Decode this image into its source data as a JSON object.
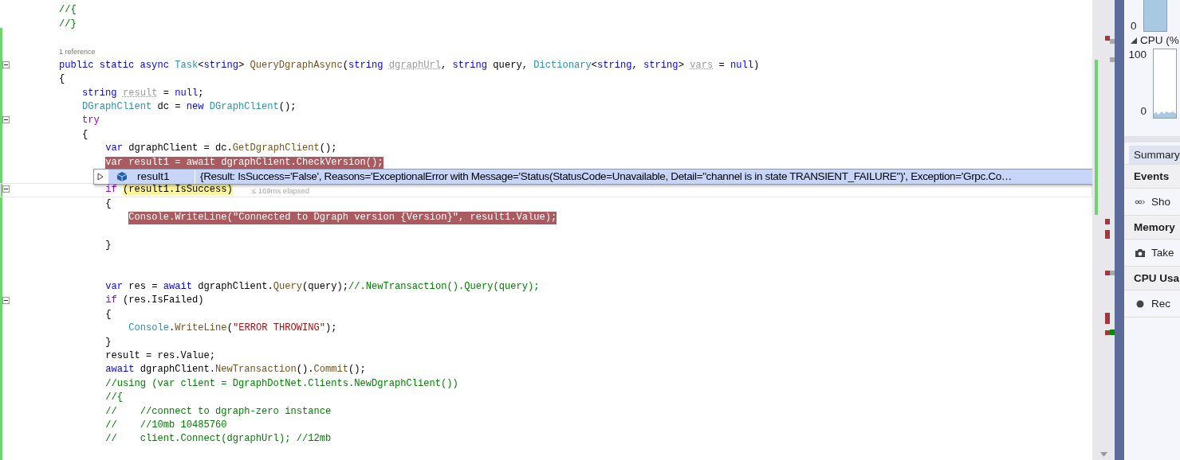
{
  "editor": {
    "lines": [
      {
        "kind": "code",
        "fold": false,
        "breakpoint": false,
        "current": false,
        "tokens": [
          {
            "kind": "comment",
            "text": "//{"
          }
        ]
      },
      {
        "kind": "code",
        "fold": false,
        "breakpoint": false,
        "current": false,
        "tokens": [
          {
            "kind": "comment",
            "text": "//}"
          }
        ]
      },
      {
        "kind": "blank"
      },
      {
        "kind": "codelens",
        "text": "1 reference"
      },
      {
        "kind": "code",
        "fold": true,
        "breakpoint": false,
        "current": false,
        "tokens": [
          {
            "kind": "kw",
            "text": "public static async "
          },
          {
            "kind": "type",
            "text": "Task"
          },
          {
            "kind": "plain",
            "text": "<"
          },
          {
            "kind": "kw",
            "text": "string"
          },
          {
            "kind": "plain",
            "text": "> "
          },
          {
            "kind": "method",
            "text": "QueryDgraphAsync"
          },
          {
            "kind": "plain",
            "text": "("
          },
          {
            "kind": "kw",
            "text": "string "
          },
          {
            "kind": "faded",
            "text": "dgraphUrl"
          },
          {
            "kind": "plain",
            "text": ", "
          },
          {
            "kind": "kw",
            "text": "string"
          },
          {
            "kind": "plain",
            "text": " query, "
          },
          {
            "kind": "type",
            "text": "Dictionary"
          },
          {
            "kind": "plain",
            "text": "<"
          },
          {
            "kind": "kw",
            "text": "string"
          },
          {
            "kind": "plain",
            "text": ", "
          },
          {
            "kind": "kw",
            "text": "string"
          },
          {
            "kind": "plain",
            "text": "> "
          },
          {
            "kind": "faded",
            "text": "vars"
          },
          {
            "kind": "plain",
            "text": " = "
          },
          {
            "kind": "kw",
            "text": "null"
          },
          {
            "kind": "plain",
            "text": ")"
          }
        ]
      },
      {
        "kind": "code",
        "fold": false,
        "breakpoint": false,
        "current": false,
        "tokens": [
          {
            "kind": "plain",
            "text": "{"
          }
        ]
      },
      {
        "kind": "code",
        "fold": false,
        "breakpoint": false,
        "current": false,
        "tokens": [
          {
            "kind": "kw",
            "text": "    string "
          },
          {
            "kind": "faded",
            "text": "result"
          },
          {
            "kind": "plain",
            "text": " = "
          },
          {
            "kind": "kw",
            "text": "null"
          },
          {
            "kind": "plain",
            "text": ";"
          }
        ]
      },
      {
        "kind": "code",
        "fold": false,
        "breakpoint": false,
        "current": false,
        "tokens": [
          {
            "kind": "type",
            "text": "    DGraphClient"
          },
          {
            "kind": "plain",
            "text": " dc = "
          },
          {
            "kind": "kw",
            "text": "new "
          },
          {
            "kind": "type",
            "text": "DGraphClient"
          },
          {
            "kind": "plain",
            "text": "();"
          }
        ]
      },
      {
        "kind": "code",
        "fold": true,
        "breakpoint": false,
        "current": false,
        "tokens": [
          {
            "kind": "ctl",
            "text": "    try"
          }
        ]
      },
      {
        "kind": "code",
        "fold": false,
        "breakpoint": false,
        "current": false,
        "tokens": [
          {
            "kind": "plain",
            "text": "    {"
          }
        ]
      },
      {
        "kind": "code",
        "fold": false,
        "breakpoint": false,
        "current": false,
        "tokens": [
          {
            "kind": "kw",
            "text": "        var"
          },
          {
            "kind": "plain",
            "text": " dgraphClient = dc."
          },
          {
            "kind": "method",
            "text": "GetDgraphClient"
          },
          {
            "kind": "plain",
            "text": "();"
          }
        ]
      },
      {
        "kind": "code",
        "fold": false,
        "breakpoint": true,
        "current": false,
        "tokens": [
          {
            "kind": "kw",
            "text": "        var"
          },
          {
            "kind": "plain",
            "text": " result1 = "
          },
          {
            "kind": "kw",
            "text": "await"
          },
          {
            "kind": "plain",
            "text": " dgraphClient."
          },
          {
            "kind": "method",
            "text": "CheckVersion"
          },
          {
            "kind": "plain",
            "text": "();"
          }
        ]
      },
      {
        "kind": "blank"
      },
      {
        "kind": "code",
        "fold": true,
        "breakpoint": false,
        "current": true,
        "hint": "≤ 169ms elapsed",
        "tokens": [
          {
            "kind": "ctl",
            "text": "        if "
          },
          {
            "kind": "active",
            "text": "(result1.IsSuccess)"
          }
        ]
      },
      {
        "kind": "code",
        "fold": false,
        "breakpoint": false,
        "current": false,
        "tokens": [
          {
            "kind": "plain",
            "text": "        {"
          }
        ]
      },
      {
        "kind": "code",
        "fold": false,
        "breakpoint": true,
        "current": false,
        "tokens": [
          {
            "kind": "type",
            "text": "            Console"
          },
          {
            "kind": "plain",
            "text": "."
          },
          {
            "kind": "method",
            "text": "WriteLine"
          },
          {
            "kind": "plain",
            "text": "("
          },
          {
            "kind": "str",
            "text": "\"Connected to Dgraph version {Version}\""
          },
          {
            "kind": "plain",
            "text": ", result1.Value);"
          }
        ]
      },
      {
        "kind": "blank"
      },
      {
        "kind": "code",
        "fold": false,
        "breakpoint": false,
        "current": false,
        "tokens": [
          {
            "kind": "plain",
            "text": "        }"
          }
        ]
      },
      {
        "kind": "blank"
      },
      {
        "kind": "blank"
      },
      {
        "kind": "code",
        "fold": false,
        "breakpoint": false,
        "current": false,
        "tokens": [
          {
            "kind": "kw",
            "text": "        var"
          },
          {
            "kind": "plain",
            "text": " res = "
          },
          {
            "kind": "kw",
            "text": "await"
          },
          {
            "kind": "plain",
            "text": " dgraphClient."
          },
          {
            "kind": "method",
            "text": "Query"
          },
          {
            "kind": "plain",
            "text": "(query);"
          },
          {
            "kind": "comment",
            "text": "//.NewTransaction().Query(query);"
          }
        ]
      },
      {
        "kind": "code",
        "fold": true,
        "breakpoint": false,
        "current": false,
        "tokens": [
          {
            "kind": "ctl",
            "text": "        if"
          },
          {
            "kind": "plain",
            "text": " (res.IsFailed)"
          }
        ]
      },
      {
        "kind": "code",
        "fold": false,
        "breakpoint": false,
        "current": false,
        "tokens": [
          {
            "kind": "plain",
            "text": "        {"
          }
        ]
      },
      {
        "kind": "code",
        "fold": false,
        "breakpoint": false,
        "current": false,
        "tokens": [
          {
            "kind": "type",
            "text": "            Console"
          },
          {
            "kind": "plain",
            "text": "."
          },
          {
            "kind": "method",
            "text": "WriteLine"
          },
          {
            "kind": "plain",
            "text": "("
          },
          {
            "kind": "str",
            "text": "\"ERROR THROWING\""
          },
          {
            "kind": "plain",
            "text": ");"
          }
        ]
      },
      {
        "kind": "code",
        "fold": false,
        "breakpoint": false,
        "current": false,
        "tokens": [
          {
            "kind": "plain",
            "text": "        }"
          }
        ]
      },
      {
        "kind": "code",
        "fold": false,
        "breakpoint": false,
        "current": false,
        "tokens": [
          {
            "kind": "plain",
            "text": "        result = res.Value;"
          }
        ]
      },
      {
        "kind": "code",
        "fold": false,
        "breakpoint": false,
        "current": false,
        "tokens": [
          {
            "kind": "kw",
            "text": "        await"
          },
          {
            "kind": "plain",
            "text": " dgraphClient."
          },
          {
            "kind": "method",
            "text": "NewTransaction"
          },
          {
            "kind": "plain",
            "text": "()."
          },
          {
            "kind": "method",
            "text": "Commit"
          },
          {
            "kind": "plain",
            "text": "();"
          }
        ]
      },
      {
        "kind": "code",
        "fold": false,
        "breakpoint": false,
        "current": false,
        "tokens": [
          {
            "kind": "comment",
            "text": "        //using (var client = DgraphDotNet.Clients.NewDgraphClient())"
          }
        ]
      },
      {
        "kind": "code",
        "fold": false,
        "breakpoint": false,
        "current": false,
        "tokens": [
          {
            "kind": "comment",
            "text": "        //{"
          }
        ]
      },
      {
        "kind": "code",
        "fold": false,
        "breakpoint": false,
        "current": false,
        "tokens": [
          {
            "kind": "comment",
            "text": "        //    //connect to dgraph-zero instance"
          }
        ]
      },
      {
        "kind": "code",
        "fold": false,
        "breakpoint": false,
        "current": false,
        "tokens": [
          {
            "kind": "comment",
            "text": "        //    //10mb 10485760"
          }
        ]
      },
      {
        "kind": "code",
        "fold": false,
        "breakpoint": false,
        "current": false,
        "tokens": [
          {
            "kind": "comment",
            "text": "        //    client.Connect(dgraphUrl); //12mb"
          }
        ]
      }
    ],
    "datatip": {
      "expanded": false,
      "name": "result1",
      "value": "{Result: IsSuccess='False', Reasons='ExceptionalError with Message='Status(StatusCode=Unavailable, Detail=\"channel is in state TRANSIENT_FAILURE\")', Exception='Grpc.Co…"
    }
  },
  "diagnostics": {
    "memory_chart": {
      "y_tick": "0"
    },
    "cpu_chart": {
      "title": "CPU (%",
      "expanded": true,
      "y_ticks": [
        "100",
        "0"
      ]
    },
    "tabs": [
      {
        "label": "Summary",
        "selected": true
      }
    ],
    "sections": [
      {
        "title": "Events",
        "kind": "events",
        "item": "Sho"
      },
      {
        "title": "Memory",
        "kind": "memory",
        "item": "Take"
      },
      {
        "title": "CPU Usa",
        "kind": "cpu",
        "item": "Rec"
      }
    ]
  }
}
